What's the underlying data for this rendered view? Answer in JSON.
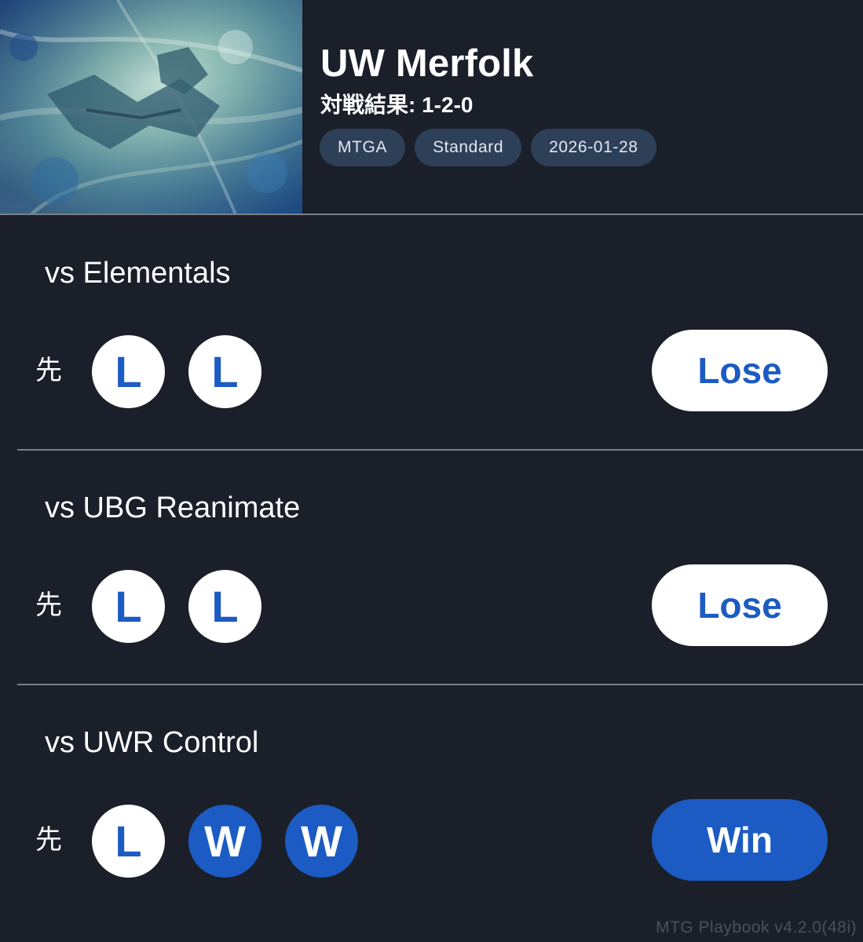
{
  "deck": {
    "title": "UW Merfolk",
    "record": "対戦結果: 1-2-0",
    "tags": [
      "MTGA",
      "Standard",
      "2026-01-28"
    ]
  },
  "matches": [
    {
      "opponent": "vs Elementals",
      "play_order": "先",
      "games": [
        "L",
        "L"
      ],
      "result": "Lose"
    },
    {
      "opponent": "vs UBG Reanimate",
      "play_order": "先",
      "games": [
        "L",
        "L"
      ],
      "result": "Lose"
    },
    {
      "opponent": "vs UWR Control",
      "play_order": "先",
      "games": [
        "L",
        "W",
        "W"
      ],
      "result": "Win"
    }
  ],
  "footer": {
    "version": "MTG Playbook v4.2.0(48i)"
  },
  "colors": {
    "background": "#1a1f29",
    "accent": "#1c5bc3",
    "tag_bg": "#2d4057",
    "divider": "#7b8088"
  }
}
